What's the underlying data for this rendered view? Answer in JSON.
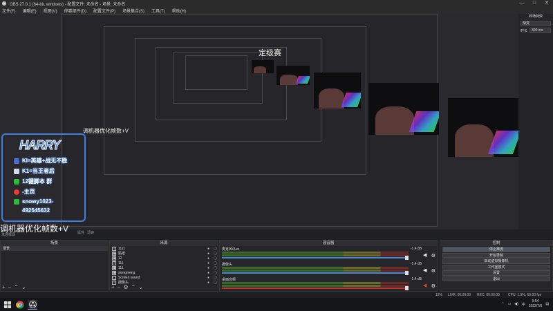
{
  "window": {
    "title": "OBS 27.0.1 (64-bit, windows) - 配置文件: 未命名 - 场景: 未命名",
    "controls": [
      "—",
      "□",
      "✕"
    ]
  },
  "menu": [
    "文件(F)",
    "编辑(E)",
    "视图(V)",
    "停靠部件(D)",
    "配置文件(P)",
    "场景集合(S)",
    "工具(T)",
    "帮助(H)"
  ],
  "overlay": {
    "title": "HARRY",
    "lines": [
      {
        "text": "KI=英雄+战无不胜",
        "color": "#4b6ad8"
      },
      {
        "text": "K1=当王者后",
        "color": "#d8d8e8"
      },
      {
        "text": "12键脚本 群",
        "color": "#2bbd3a"
      },
      {
        "text": "-主页",
        "color": "#e23a3a"
      },
      {
        "text": "snowy1023-",
        "color": "#2bbd3a"
      },
      {
        "text": "492545632",
        "color": "#2bbd3a"
      }
    ]
  },
  "banner": "调机器优化帧数+V",
  "preview_title_small": "定级赛",
  "right_panel": {
    "header": "转场特效",
    "transition_value": "渐变",
    "duration_label": "时长",
    "duration_value": "300 ms"
  },
  "scene_label": "未选择源",
  "tabs": [
    "属性",
    "滤镜"
  ],
  "scenes_dock": {
    "header": "场景",
    "items": [
      "场景"
    ]
  },
  "sources_dock": {
    "header": "来源",
    "items": [
      "1111",
      "贴纸",
      "12",
      "111",
      "111",
      "xiongmeng",
      "ScreEn sound",
      "摄像头"
    ]
  },
  "mixer_dock": {
    "header": "混音器",
    "channels": [
      {
        "name": "麦克风/Aux",
        "db": "-1.4 dB"
      },
      {
        "name": "摄像头",
        "db": "-1.4 dB"
      },
      {
        "name": "桌面音频",
        "db": "-1.4 dB"
      }
    ]
  },
  "controls_dock": {
    "header": "控制",
    "buttons": [
      "停止推流",
      "开始录制",
      "启动虚拟摄像机",
      "工作室模式",
      "设置",
      "退出"
    ]
  },
  "status": {
    "live": "LIVE: 00:00:00",
    "rec": "REC: 00:00:00",
    "cpu": "CPU: 1.9%, 60.00 fps",
    "kbps": "12%"
  },
  "taskbar": {
    "time": "9:54",
    "date": "2022/7/6",
    "lang": "中"
  }
}
